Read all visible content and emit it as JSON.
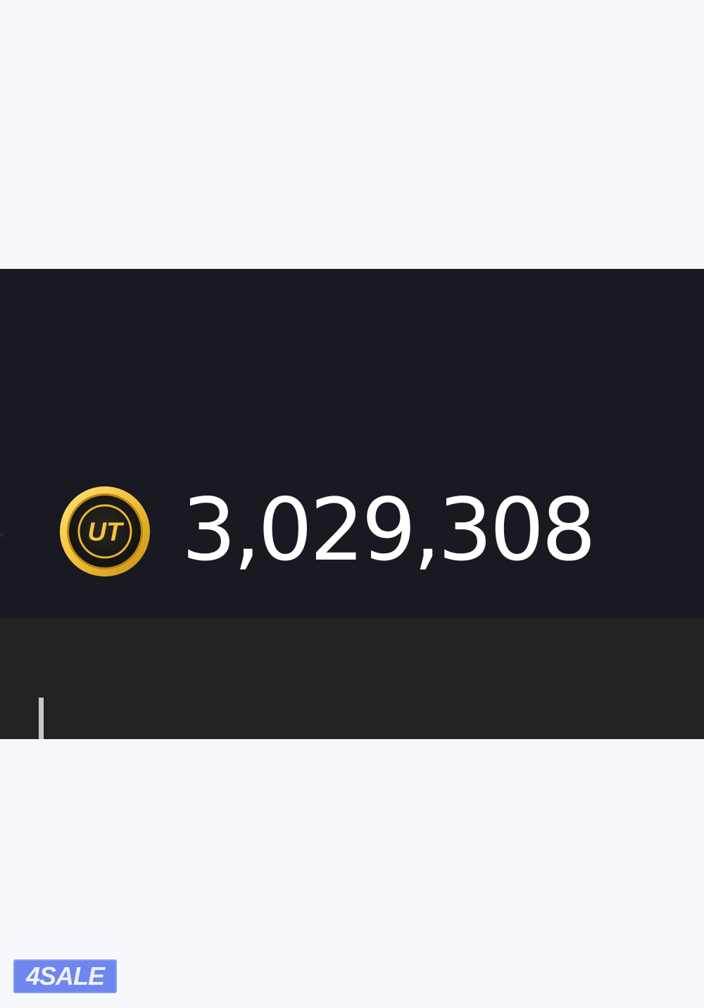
{
  "coin": {
    "icon": "ut-coin-icon",
    "symbol": "UT",
    "balance": "3,029,308"
  },
  "watermark": {
    "label": "4SALE"
  },
  "colors": {
    "top_bar": "#191922",
    "lower_panel": "#222223",
    "coin_gold": "#f3c43c",
    "watermark_blue": "#6f86f0"
  }
}
